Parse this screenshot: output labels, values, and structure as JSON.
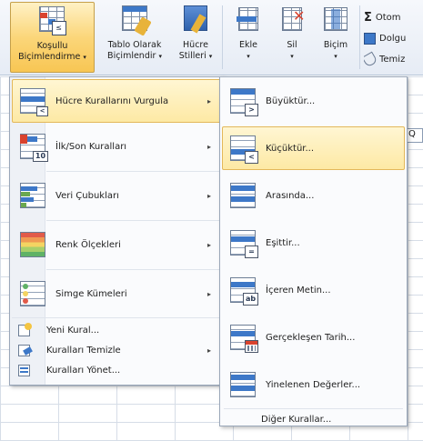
{
  "ribbon": {
    "conditional_formatting": {
      "line1": "Koşullu",
      "line2": "Biçimlendirme",
      "caret": "▾"
    },
    "format_as_table": {
      "line1": "Tablo Olarak",
      "line2": "Biçimlendir",
      "caret": "▾"
    },
    "cell_styles": {
      "line1": "Hücre",
      "line2": "Stilleri",
      "caret": "▾"
    },
    "insert": {
      "label": "Ekle",
      "caret": "▾"
    },
    "delete": {
      "label": "Sil",
      "caret": "▾"
    },
    "format": {
      "label": "Biçim",
      "caret": "▾"
    },
    "autosum": {
      "label": "Otom",
      "icon": "Σ"
    },
    "fill": {
      "label": "Dolgu"
    },
    "clear": {
      "label": "Temiz"
    }
  },
  "sheet": {
    "cell_fragment": "Q"
  },
  "left_menu": {
    "items": [
      {
        "label": "Hücre Kurallarını Vurgula",
        "has_submenu": true,
        "highlighted": true,
        "icon": "highlight-cells-icon"
      },
      {
        "label": "İlk/Son Kuralları",
        "has_submenu": true,
        "icon": "top-bottom-icon",
        "badge": "10"
      },
      {
        "label": "Veri Çubukları",
        "has_submenu": true,
        "icon": "data-bars-icon"
      },
      {
        "label": "Renk Ölçekleri",
        "has_submenu": true,
        "icon": "color-scales-icon"
      },
      {
        "label": "Simge Kümeleri",
        "has_submenu": true,
        "icon": "icon-sets-icon"
      }
    ],
    "small_items": [
      {
        "label": "Yeni Kural...",
        "has_submenu": false,
        "icon": "new-rule-icon"
      },
      {
        "label": "Kuralları Temizle",
        "has_submenu": true,
        "icon": "clear-rules-icon"
      },
      {
        "label": "Kuralları Yönet...",
        "has_submenu": false,
        "icon": "manage-rules-icon"
      }
    ],
    "arrow": "▸"
  },
  "right_menu": {
    "items": [
      {
        "label": "Büyüktür...",
        "icon": "greater-than-icon",
        "tag": ">"
      },
      {
        "label": "Küçüktür...",
        "icon": "less-than-icon",
        "tag": "<",
        "highlighted": true
      },
      {
        "label": "Arasında...",
        "icon": "between-icon"
      },
      {
        "label": "Eşittir...",
        "icon": "equal-to-icon",
        "tag": "="
      },
      {
        "label": "İçeren Metin...",
        "icon": "text-contains-icon",
        "tag": "ab"
      },
      {
        "label": "Gerçekleşen Tarih...",
        "icon": "date-occurring-icon"
      },
      {
        "label": "Yinelenen Değerler...",
        "icon": "duplicate-values-icon"
      }
    ],
    "more_rules": "Diğer Kurallar..."
  },
  "colors": {
    "menu_highlight": "#fde9a5",
    "ribbon_active": "#fbd67a",
    "icon_blue": "#3d78c8"
  }
}
